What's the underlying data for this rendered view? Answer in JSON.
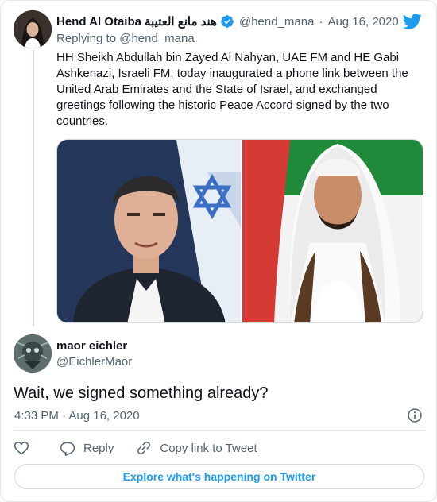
{
  "parent_tweet": {
    "author_name": "Hend Al Otaiba",
    "author_name_arabic": "هند مانع العتيبة",
    "handle": "@hend_mana",
    "separator": "·",
    "date": "Aug 16, 2020",
    "replying_to_prefix": "Replying to",
    "replying_to_handle": "@hend_mana",
    "text": "HH Sheikh Abdullah bin Zayed Al Nahyan, UAE FM and HE Gabi Ashkenazi, Israeli FM, today inaugurated a phone link between the United Arab Emirates and the State of Israel, and exchanged greetings following the historic Peace Accord signed by the two countries."
  },
  "main_tweet": {
    "author_name": "maor eichler",
    "handle": "@EichlerMaor",
    "text": "Wait, we signed something already?",
    "timestamp": "4:33 PM · Aug 16, 2020"
  },
  "actions": {
    "reply_label": "Reply",
    "copy_link_label": "Copy link to Tweet"
  },
  "footer": {
    "explore_label": "Explore what's happening on Twitter"
  },
  "icons": {
    "brand": "twitter-bird-icon",
    "verified": "verified-badge-icon",
    "info": "info-icon",
    "like": "heart-icon",
    "reply": "reply-icon",
    "copy_link": "link-icon"
  },
  "colors": {
    "brand_blue": "#1d9bf0",
    "text_primary": "#0f1419",
    "text_secondary": "#536471",
    "border": "#cfd9de"
  }
}
